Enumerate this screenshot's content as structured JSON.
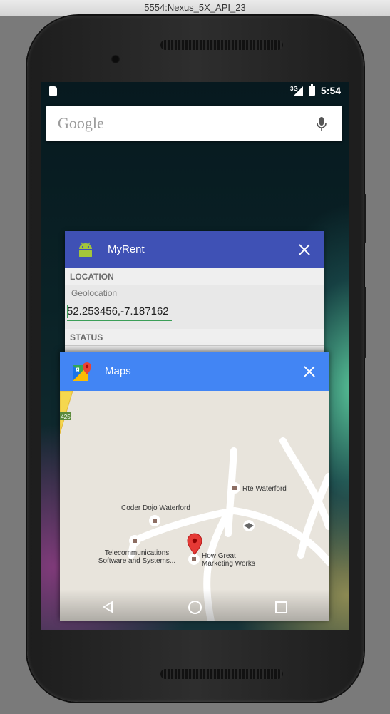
{
  "window": {
    "title": "5554:Nexus_5X_API_23"
  },
  "status_bar": {
    "network": "3G",
    "time": "5:54"
  },
  "search": {
    "logo": "Google"
  },
  "recents": [
    {
      "app": "MyRent",
      "header_color": "#3f51b5",
      "icon": "android-icon",
      "sections": {
        "location": "LOCATION",
        "geolocation_label": "Geolocation",
        "geolocation_value": "52.253456,-7.187162",
        "status": "STATUS"
      }
    },
    {
      "app": "Maps",
      "header_color": "#4285f4",
      "icon": "google-maps-icon",
      "map_labels": {
        "route_badge": "425",
        "rte": "Rte Waterford",
        "coder_dojo": "Coder Dojo Waterford",
        "telecom_line1": "Telecommunications",
        "telecom_line2": "Software and Systems...",
        "how_great_line1": "How Great",
        "how_great_line2": "Marketing Works"
      }
    }
  ],
  "nav": {
    "back": "back-icon",
    "home": "home-icon",
    "recents": "recents-icon"
  }
}
